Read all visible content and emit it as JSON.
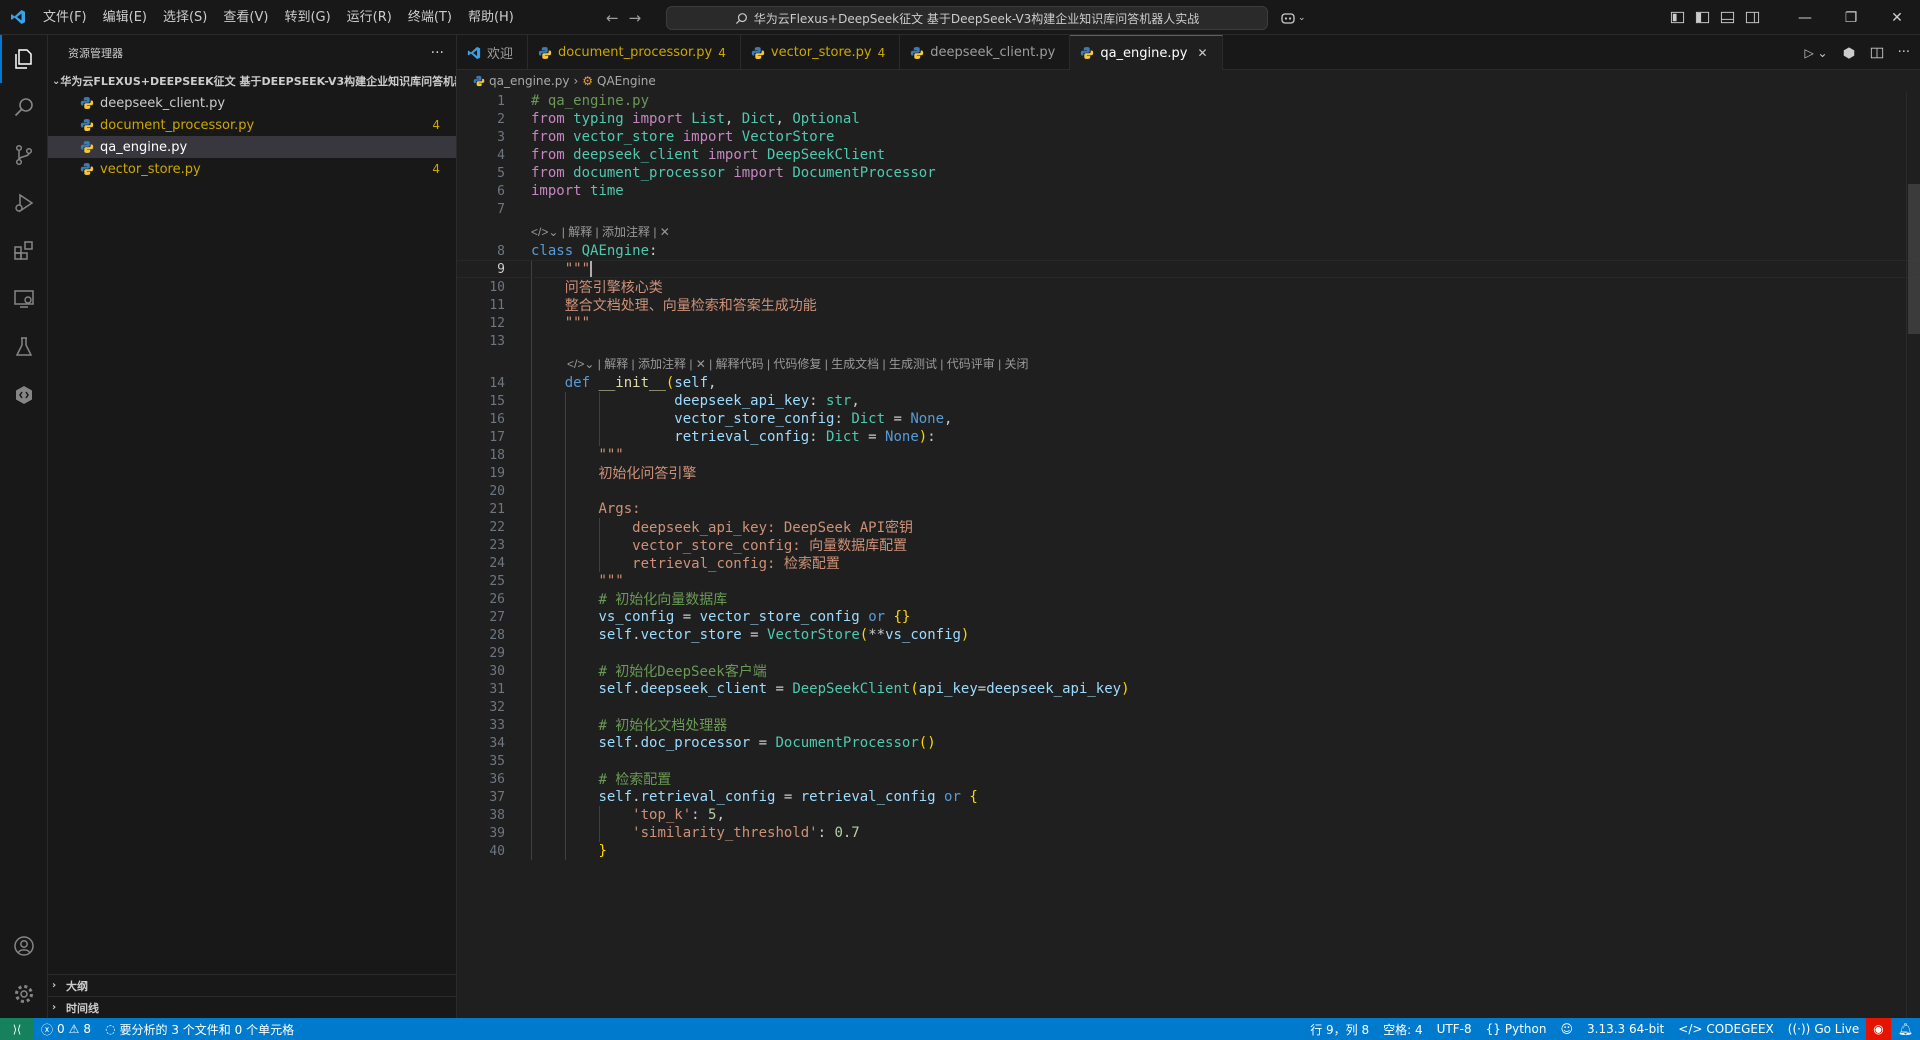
{
  "titlebar": {
    "menus": [
      "文件(F)",
      "编辑(E)",
      "选择(S)",
      "查看(V)",
      "转到(G)",
      "运行(R)",
      "终端(T)",
      "帮助(H)"
    ],
    "search_text": "华为云Flexus+DeepSeek征文 基于DeepSeek-V3构建企业知识库问答机器人实战"
  },
  "sidebar": {
    "title": "资源管理器",
    "folder": "华为云FLEXUS+DEEPSEEK征文 基于DEEPSEEK-V3构建企业知识库问答机器...",
    "files": [
      {
        "name": "deepseek_client.py",
        "badge": "",
        "color": "#cccccc"
      },
      {
        "name": "document_processor.py",
        "badge": "4",
        "color": "#cca700"
      },
      {
        "name": "qa_engine.py",
        "badge": "",
        "color": "#ffffff"
      },
      {
        "name": "vector_store.py",
        "badge": "4",
        "color": "#cca700"
      }
    ],
    "outline": "大纲",
    "timeline": "时间线"
  },
  "tabs": [
    {
      "name": "欢迎",
      "badge": "",
      "icon": "vscode-icon"
    },
    {
      "name": "document_processor.py",
      "badge": "4",
      "icon": "python-icon"
    },
    {
      "name": "vector_store.py",
      "badge": "4",
      "icon": "python-icon"
    },
    {
      "name": "deepseek_client.py",
      "badge": "",
      "icon": "python-icon"
    },
    {
      "name": "qa_engine.py",
      "badge": "",
      "icon": "python-icon"
    }
  ],
  "breadcrumb": {
    "file": "qa_engine.py",
    "symbol": "QAEngine"
  },
  "code": {
    "lens1": "| 解释 | 添加注释 | ✕",
    "lens2": "| 解释 | 添加注释 | ✕ | 解释代码 | 代码修复 | 生成文档 | 生成测试 | 代码评审 | 关闭",
    "line_numbers": [
      "1",
      "2",
      "3",
      "4",
      "5",
      "6",
      "7",
      "8",
      "9",
      "10",
      "11",
      "12",
      "13",
      "14",
      "15",
      "16",
      "17",
      "18",
      "19",
      "20",
      "21",
      "22",
      "23",
      "24",
      "25",
      "26",
      "27",
      "28",
      "29",
      "30",
      "31",
      "32",
      "33",
      "34",
      "35",
      "36",
      "37",
      "38",
      "39",
      "40"
    ],
    "current_line": "9"
  },
  "statusbar": {
    "errors": "0",
    "warnings": "8",
    "analysis": "要分析的 3 个文件和 0 个单元格",
    "position": "行 9，列 8",
    "spaces": "空格: 4",
    "encoding": "UTF-8",
    "language": "Python",
    "interpreter": "3.13.3 64-bit",
    "codegeex": "CODEGEEX",
    "golive": "Go Live"
  },
  "colors": {
    "accent": "#007acc",
    "warning": "#cca700",
    "bg": "#1f1f1f"
  }
}
